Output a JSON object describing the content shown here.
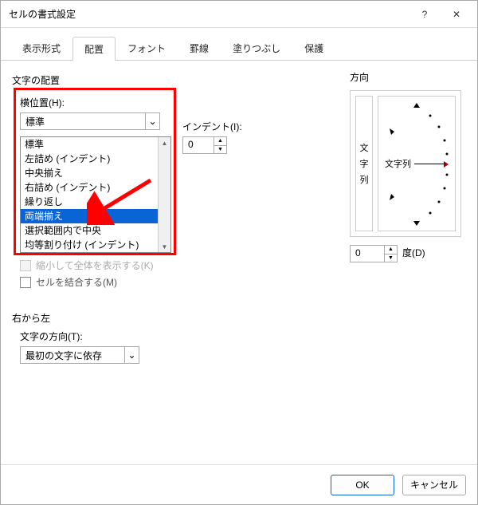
{
  "window": {
    "title": "セルの書式設定"
  },
  "tabs": {
    "items": [
      {
        "label": "表示形式"
      },
      {
        "label": "配置"
      },
      {
        "label": "フォント"
      },
      {
        "label": "罫線"
      },
      {
        "label": "塗りつぶし"
      },
      {
        "label": "保護"
      }
    ],
    "active_index": 1
  },
  "alignment": {
    "group_label": "文字の配置",
    "horizontal_label": "横位置(H):",
    "horizontal_value": "標準",
    "horizontal_options": [
      "標準",
      "左詰め (インデント)",
      "中央揃え",
      "右詰め (インデント)",
      "繰り返し",
      "両端揃え",
      "選択範囲内で中央",
      "均等割り付け (インデント)"
    ],
    "horizontal_selected_index": 5,
    "indent_label": "インデント(I):",
    "indent_value": "0"
  },
  "text_control": {
    "shrink_label": "縮小して全体を表示する(K)",
    "merge_label": "セルを結合する(M)"
  },
  "orientation": {
    "group_label": "方向",
    "vertical_text": "文字列",
    "dial_text": "文字列",
    "degree_value": "0",
    "degree_label": "度(D)"
  },
  "rtl": {
    "group_label": "右から左",
    "direction_label": "文字の方向(T):",
    "direction_value": "最初の文字に依存"
  },
  "buttons": {
    "ok": "OK",
    "cancel": "キャンセル"
  },
  "icons": {
    "help": "?",
    "close": "✕",
    "chevron_down": "⌄",
    "up": "▲",
    "down": "▼"
  }
}
